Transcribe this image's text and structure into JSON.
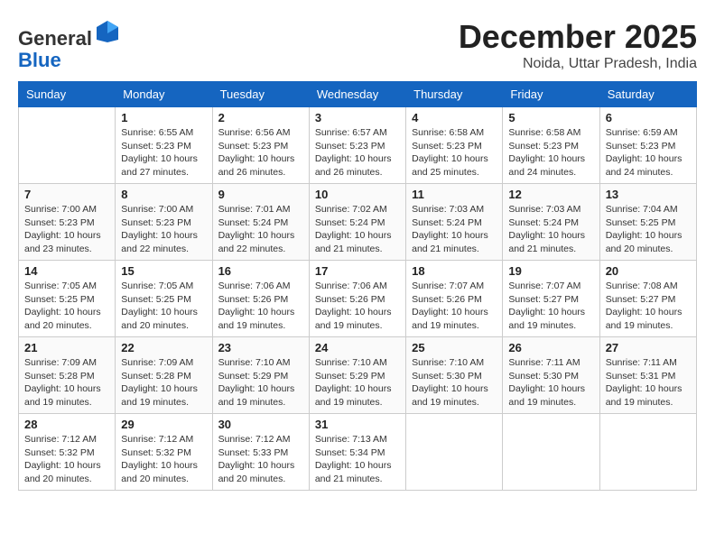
{
  "logo": {
    "general": "General",
    "blue": "Blue"
  },
  "header": {
    "month": "December 2025",
    "location": "Noida, Uttar Pradesh, India"
  },
  "weekdays": [
    "Sunday",
    "Monday",
    "Tuesday",
    "Wednesday",
    "Thursday",
    "Friday",
    "Saturday"
  ],
  "weeks": [
    [
      {
        "day": "",
        "info": ""
      },
      {
        "day": "1",
        "info": "Sunrise: 6:55 AM\nSunset: 5:23 PM\nDaylight: 10 hours\nand 27 minutes."
      },
      {
        "day": "2",
        "info": "Sunrise: 6:56 AM\nSunset: 5:23 PM\nDaylight: 10 hours\nand 26 minutes."
      },
      {
        "day": "3",
        "info": "Sunrise: 6:57 AM\nSunset: 5:23 PM\nDaylight: 10 hours\nand 26 minutes."
      },
      {
        "day": "4",
        "info": "Sunrise: 6:58 AM\nSunset: 5:23 PM\nDaylight: 10 hours\nand 25 minutes."
      },
      {
        "day": "5",
        "info": "Sunrise: 6:58 AM\nSunset: 5:23 PM\nDaylight: 10 hours\nand 24 minutes."
      },
      {
        "day": "6",
        "info": "Sunrise: 6:59 AM\nSunset: 5:23 PM\nDaylight: 10 hours\nand 24 minutes."
      }
    ],
    [
      {
        "day": "7",
        "info": "Sunrise: 7:00 AM\nSunset: 5:23 PM\nDaylight: 10 hours\nand 23 minutes."
      },
      {
        "day": "8",
        "info": "Sunrise: 7:00 AM\nSunset: 5:23 PM\nDaylight: 10 hours\nand 22 minutes."
      },
      {
        "day": "9",
        "info": "Sunrise: 7:01 AM\nSunset: 5:24 PM\nDaylight: 10 hours\nand 22 minutes."
      },
      {
        "day": "10",
        "info": "Sunrise: 7:02 AM\nSunset: 5:24 PM\nDaylight: 10 hours\nand 21 minutes."
      },
      {
        "day": "11",
        "info": "Sunrise: 7:03 AM\nSunset: 5:24 PM\nDaylight: 10 hours\nand 21 minutes."
      },
      {
        "day": "12",
        "info": "Sunrise: 7:03 AM\nSunset: 5:24 PM\nDaylight: 10 hours\nand 21 minutes."
      },
      {
        "day": "13",
        "info": "Sunrise: 7:04 AM\nSunset: 5:25 PM\nDaylight: 10 hours\nand 20 minutes."
      }
    ],
    [
      {
        "day": "14",
        "info": "Sunrise: 7:05 AM\nSunset: 5:25 PM\nDaylight: 10 hours\nand 20 minutes."
      },
      {
        "day": "15",
        "info": "Sunrise: 7:05 AM\nSunset: 5:25 PM\nDaylight: 10 hours\nand 20 minutes."
      },
      {
        "day": "16",
        "info": "Sunrise: 7:06 AM\nSunset: 5:26 PM\nDaylight: 10 hours\nand 19 minutes."
      },
      {
        "day": "17",
        "info": "Sunrise: 7:06 AM\nSunset: 5:26 PM\nDaylight: 10 hours\nand 19 minutes."
      },
      {
        "day": "18",
        "info": "Sunrise: 7:07 AM\nSunset: 5:26 PM\nDaylight: 10 hours\nand 19 minutes."
      },
      {
        "day": "19",
        "info": "Sunrise: 7:07 AM\nSunset: 5:27 PM\nDaylight: 10 hours\nand 19 minutes."
      },
      {
        "day": "20",
        "info": "Sunrise: 7:08 AM\nSunset: 5:27 PM\nDaylight: 10 hours\nand 19 minutes."
      }
    ],
    [
      {
        "day": "21",
        "info": "Sunrise: 7:09 AM\nSunset: 5:28 PM\nDaylight: 10 hours\nand 19 minutes."
      },
      {
        "day": "22",
        "info": "Sunrise: 7:09 AM\nSunset: 5:28 PM\nDaylight: 10 hours\nand 19 minutes."
      },
      {
        "day": "23",
        "info": "Sunrise: 7:10 AM\nSunset: 5:29 PM\nDaylight: 10 hours\nand 19 minutes."
      },
      {
        "day": "24",
        "info": "Sunrise: 7:10 AM\nSunset: 5:29 PM\nDaylight: 10 hours\nand 19 minutes."
      },
      {
        "day": "25",
        "info": "Sunrise: 7:10 AM\nSunset: 5:30 PM\nDaylight: 10 hours\nand 19 minutes."
      },
      {
        "day": "26",
        "info": "Sunrise: 7:11 AM\nSunset: 5:30 PM\nDaylight: 10 hours\nand 19 minutes."
      },
      {
        "day": "27",
        "info": "Sunrise: 7:11 AM\nSunset: 5:31 PM\nDaylight: 10 hours\nand 19 minutes."
      }
    ],
    [
      {
        "day": "28",
        "info": "Sunrise: 7:12 AM\nSunset: 5:32 PM\nDaylight: 10 hours\nand 20 minutes."
      },
      {
        "day": "29",
        "info": "Sunrise: 7:12 AM\nSunset: 5:32 PM\nDaylight: 10 hours\nand 20 minutes."
      },
      {
        "day": "30",
        "info": "Sunrise: 7:12 AM\nSunset: 5:33 PM\nDaylight: 10 hours\nand 20 minutes."
      },
      {
        "day": "31",
        "info": "Sunrise: 7:13 AM\nSunset: 5:34 PM\nDaylight: 10 hours\nand 21 minutes."
      },
      {
        "day": "",
        "info": ""
      },
      {
        "day": "",
        "info": ""
      },
      {
        "day": "",
        "info": ""
      }
    ]
  ]
}
